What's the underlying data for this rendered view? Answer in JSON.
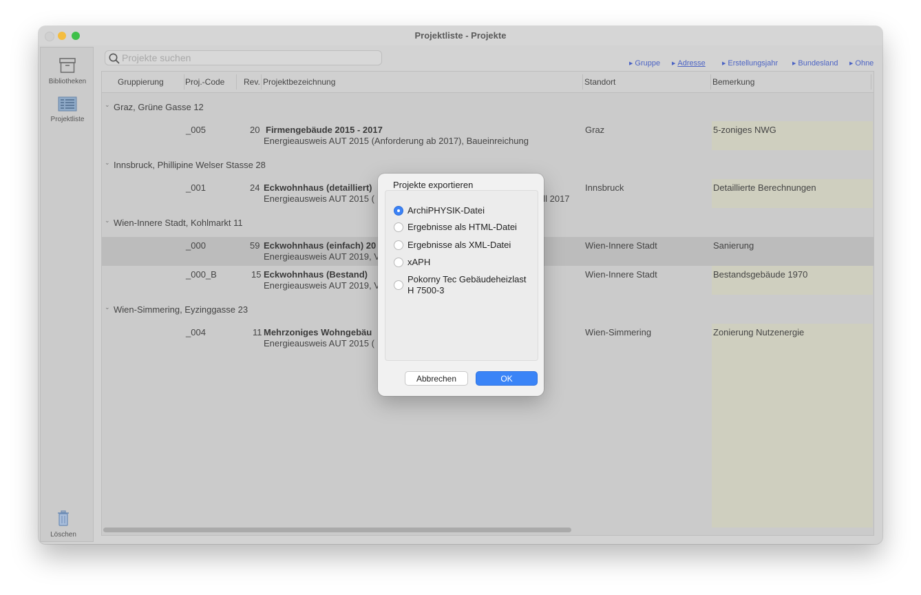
{
  "window": {
    "title": "Projektliste - Projekte"
  },
  "sidebar": {
    "items": [
      {
        "label": "Bibliotheken",
        "icon": "archive-box-icon"
      },
      {
        "label": "Projektliste",
        "icon": "list-icon"
      }
    ],
    "delete_label": "Löschen"
  },
  "search": {
    "placeholder": "Projekte suchen"
  },
  "grouping": {
    "options": [
      "Gruppe",
      "Adresse",
      "Erstellungsjahr",
      "Bundesland",
      "Ohne"
    ],
    "selected": "Adresse"
  },
  "table": {
    "headers": [
      "Gruppierung",
      "Proj.-Code",
      "Rev.",
      "Projektbezeichnung",
      "Standort",
      "Bemerkung"
    ],
    "groups": [
      {
        "label": "Graz, Grüne Gasse 12",
        "rows": [
          {
            "code": "_005",
            "rev": "20",
            "title": "Firmengebäude 2015 - 2017",
            "subtitle": "Energieausweis AUT 2015 (Anforderung ab 2017), Baueinreichung",
            "standort": "Graz",
            "bemerkung": "5-zoniges NWG"
          }
        ]
      },
      {
        "label": "Innsbruck, Phillipine Welser Stasse 28",
        "rows": [
          {
            "code": "_001",
            "rev": "24",
            "title": "Eckwohnhaus (detailliert)",
            "subtitle": "Energieausweis AUT 2015 (",
            "subtitle_tail": "ell 2017",
            "standort": "Innsbruck",
            "bemerkung": "Detaillierte Berechnungen"
          }
        ]
      },
      {
        "label": "Wien-Innere Stadt, Kohlmarkt 11",
        "rows": [
          {
            "code": "_000",
            "rev": "59",
            "title": "Eckwohnhaus (einfach) 20",
            "subtitle": "Energieausweis AUT 2019, V",
            "standort": "Wien-Innere Stadt",
            "bemerkung": "Sanierung",
            "selected": true
          },
          {
            "code": "_000_B",
            "rev": "15",
            "title": "Eckwohnhaus (Bestand)",
            "subtitle": "Energieausweis AUT 2019, V",
            "standort": "Wien-Innere Stadt",
            "bemerkung": "Bestandsgebäude 1970"
          }
        ]
      },
      {
        "label": "Wien-Simmering, Eyzinggasse 23",
        "rows": [
          {
            "code": "_004",
            "rev": "11",
            "title": "Mehrzoniges Wohngebäu",
            "subtitle": "Energieausweis AUT 2015 (",
            "standort": "Wien-Simmering",
            "bemerkung": "Zonierung Nutzenergie"
          }
        ]
      }
    ]
  },
  "dialog": {
    "title": "Projekte  exportieren",
    "options": [
      {
        "label": "ArchiPHYSIK-Datei",
        "selected": true
      },
      {
        "label": "Ergebnisse als HTML-Datei",
        "selected": false
      },
      {
        "label": "Ergebnisse als XML-Datei",
        "selected": false
      },
      {
        "label": "xAPH",
        "selected": false
      },
      {
        "label": "Pokorny Tec Gebäudeheizlast",
        "label2": "H 7500-3",
        "selected": false
      }
    ],
    "cancel_label": "Abbrechen",
    "ok_label": "OK"
  },
  "colors": {
    "accent": "#3a84f7",
    "link": "#4b63c4",
    "note_bg": "#cfcfbf"
  }
}
